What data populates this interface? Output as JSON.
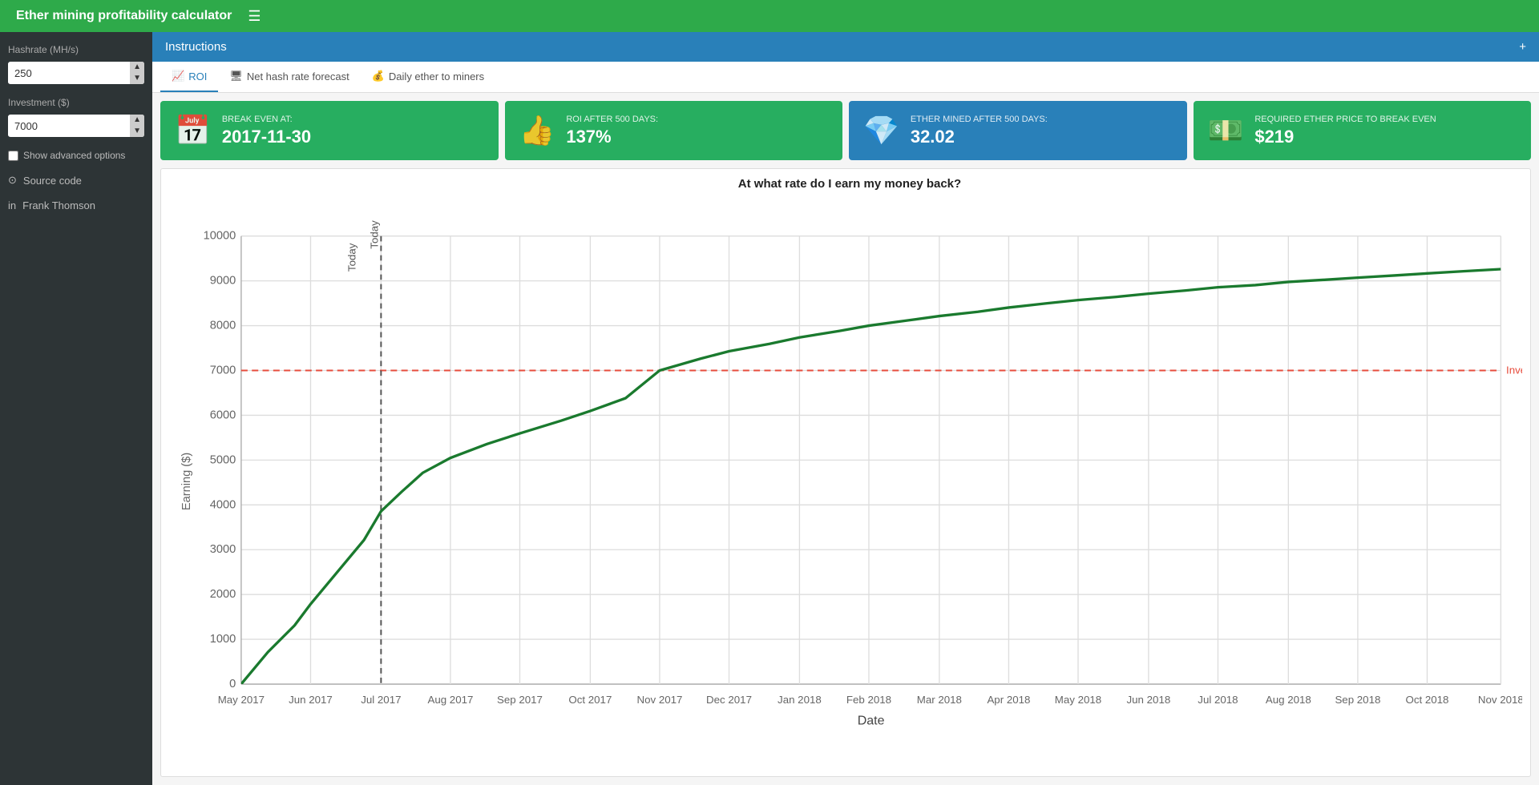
{
  "topbar": {
    "title": "Ether mining profitability calculator",
    "menu_label": "☰"
  },
  "sidebar": {
    "hashrate_label": "Hashrate (MH/s)",
    "hashrate_value": "250",
    "investment_label": "Investment ($)",
    "investment_value": "7000",
    "advanced_options_label": "Show advanced options",
    "source_code_label": "Source code",
    "author_label": "Frank Thomson"
  },
  "instructions_label": "Instructions",
  "instructions_plus": "+",
  "tabs": [
    {
      "id": "roi",
      "label": "ROI",
      "active": true,
      "icon": "📈"
    },
    {
      "id": "nethash",
      "label": "Net hash rate forecast",
      "active": false,
      "icon": "🖥"
    },
    {
      "id": "daily",
      "label": "Daily ether to miners",
      "active": false,
      "icon": "💰"
    }
  ],
  "stat_cards": [
    {
      "color": "green",
      "label": "BREAK EVEN AT:",
      "value": "2017-11-30",
      "icon": "📅"
    },
    {
      "color": "green",
      "label": "ROI AFTER 500 DAYS:",
      "value": "137%",
      "icon": "👍"
    },
    {
      "color": "blue",
      "label": "ETHER MINED AFTER 500 DAYS:",
      "value": "32.02",
      "icon": "💎"
    },
    {
      "color": "green",
      "label": "REQUIRED ETHER PRICE TO BREAK EVEN",
      "value": "$219",
      "icon": "💵"
    }
  ],
  "chart": {
    "title": "At what rate do I earn my money back?",
    "y_label": "Earning ($)",
    "x_label": "Date",
    "investment_line_label": "Investment",
    "investment_value": 7000,
    "y_ticks": [
      0,
      1000,
      2000,
      3000,
      4000,
      5000,
      6000,
      7000,
      8000,
      9000,
      10000
    ],
    "x_labels": [
      "May 2017",
      "Jun 2017",
      "Jul 2017",
      "Aug 2017",
      "Sep 2017",
      "Oct 2017",
      "Nov 2017",
      "Dec 2017",
      "Jan 2018",
      "Feb 2018",
      "Mar 2018",
      "Apr 2018",
      "May 2018",
      "Jun 2018",
      "Jul 2018",
      "Aug 2018",
      "Sep 2018",
      "Oct 2018",
      "Nov 2018"
    ],
    "today_label": "Today"
  }
}
